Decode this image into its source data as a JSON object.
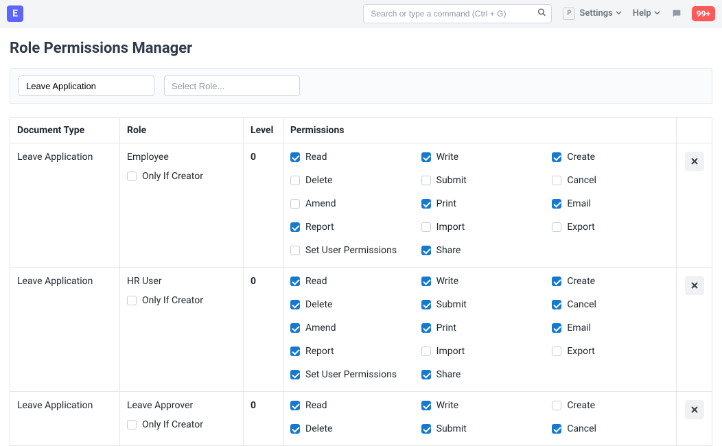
{
  "navbar": {
    "logo_text": "E",
    "search_placeholder": "Search or type a command (Ctrl + G)",
    "settings_key": "P",
    "settings_label": "Settings",
    "help_label": "Help",
    "notif_count": "99+"
  },
  "page_title": "Role Permissions Manager",
  "filters": {
    "doctype_value": "Leave Application",
    "role_placeholder": "Select Role..."
  },
  "columns": {
    "doctype": "Document Type",
    "role": "Role",
    "level": "Level",
    "permissions": "Permissions"
  },
  "labels": {
    "only_if_creator": "Only If Creator"
  },
  "perm_labels": {
    "read": "Read",
    "write": "Write",
    "create": "Create",
    "delete": "Delete",
    "submit": "Submit",
    "cancel": "Cancel",
    "amend": "Amend",
    "print": "Print",
    "email": "Email",
    "report": "Report",
    "import": "Import",
    "export": "Export",
    "set_user_permissions": "Set User Permissions",
    "share": "Share"
  },
  "rows": [
    {
      "doctype": "Leave Application",
      "role": "Employee",
      "level": "0",
      "only_if_creator": false,
      "perms": {
        "read": true,
        "write": true,
        "create": true,
        "delete": false,
        "submit": false,
        "cancel": false,
        "amend": false,
        "print": true,
        "email": true,
        "report": true,
        "import": false,
        "export": false,
        "set_user_permissions": false,
        "share": true
      }
    },
    {
      "doctype": "Leave Application",
      "role": "HR User",
      "level": "0",
      "only_if_creator": false,
      "perms": {
        "read": true,
        "write": true,
        "create": true,
        "delete": true,
        "submit": true,
        "cancel": true,
        "amend": true,
        "print": true,
        "email": true,
        "report": true,
        "import": false,
        "export": false,
        "set_user_permissions": true,
        "share": true
      }
    },
    {
      "doctype": "Leave Application",
      "role": "Leave Approver",
      "level": "0",
      "only_if_creator": false,
      "perms": {
        "read": true,
        "write": true,
        "create": false,
        "delete": true,
        "submit": true,
        "cancel": true
      }
    }
  ]
}
